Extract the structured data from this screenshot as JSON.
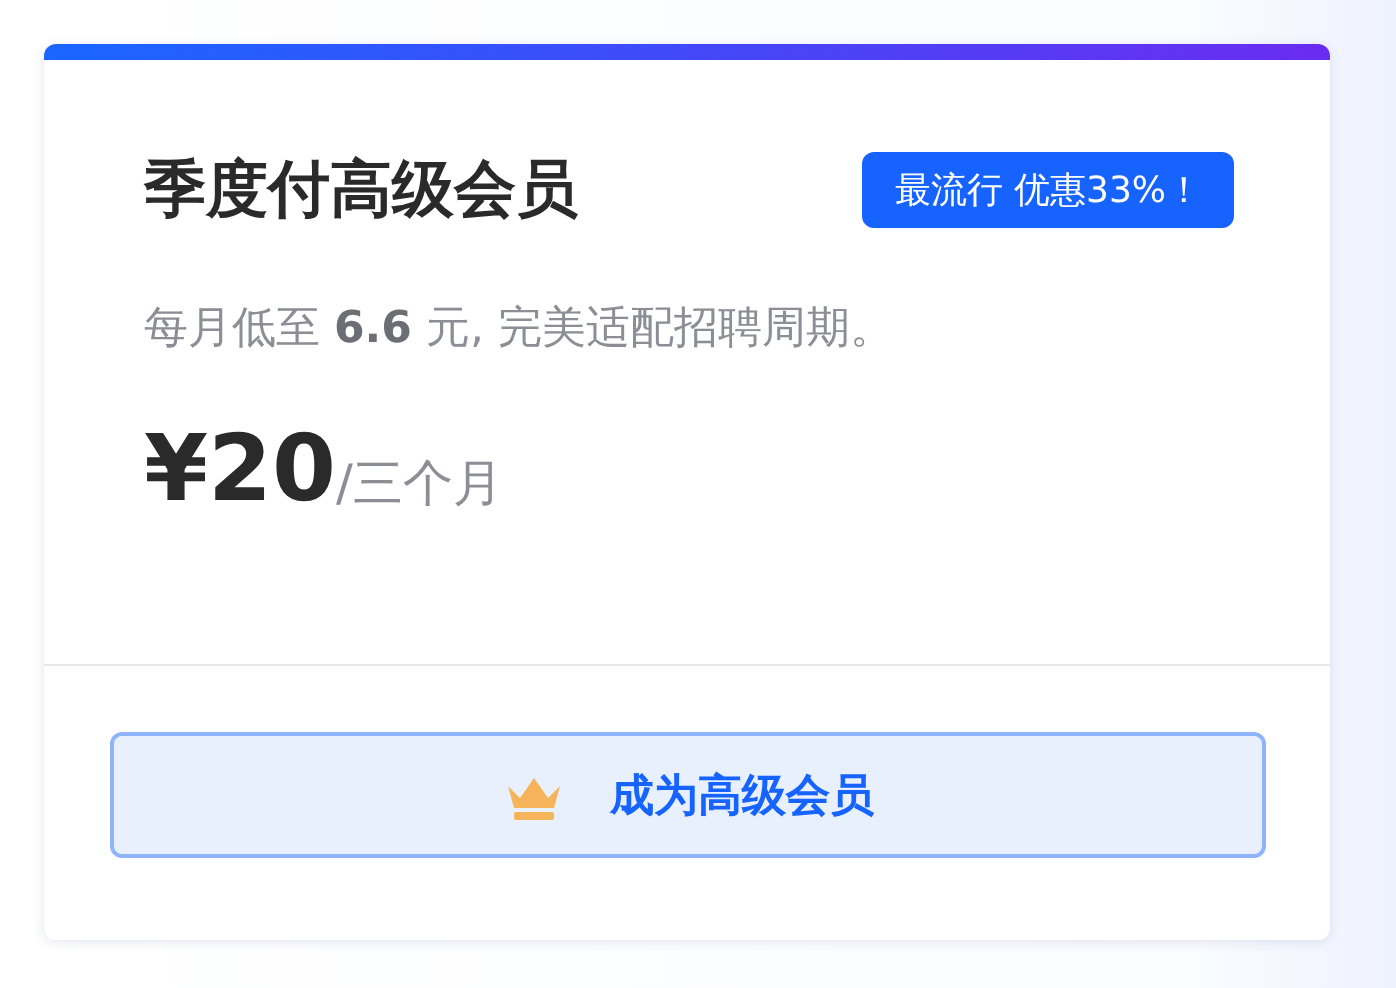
{
  "plan": {
    "title": "季度付高级会员",
    "badge": "最流行 优惠33%！",
    "description": "每月低至 **6.6** 元, 完美适配招聘周期。",
    "price": "¥20",
    "period": "/三个月"
  },
  "button": {
    "label": "成为高级会员"
  }
}
